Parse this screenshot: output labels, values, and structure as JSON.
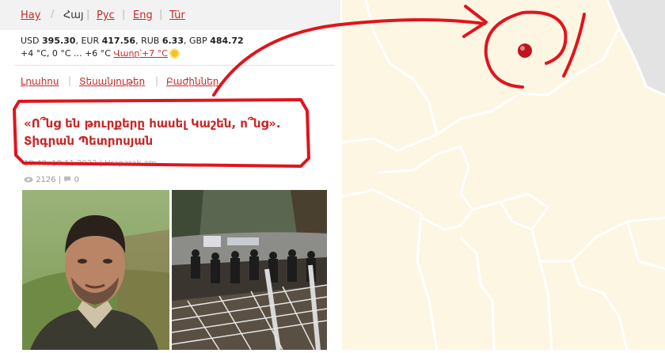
{
  "languages": [
    "Հայ",
    "Հայ",
    "Рус",
    "Eng",
    "Tür"
  ],
  "languages_display": {
    "hay_latin": "Hay",
    "hay": "Հայ",
    "rus": "Рус",
    "eng": "Eng",
    "tur": "Tür"
  },
  "rates": {
    "usd_label": "USD",
    "usd": "395.30",
    "eur_label": "EUR",
    "eur": "417.56",
    "rub_label": "RUB",
    "rub": "6.33",
    "gbp_label": "GBP",
    "gbp": "484.72"
  },
  "weather": {
    "temps": "+4 °C, 0 °C ... +6 °C",
    "tomorrow": "Վաղը՝+7 °C"
  },
  "nav": {
    "news": "Լրահոս",
    "videos": "Տեսանյութեր",
    "sections": "Բաժիններ"
  },
  "article": {
    "title": "«Ո՞նց են թուրքերը հասել Կաշեն, ո՞նց». Տիգրան Պետրոսյան",
    "date": "19:40, 10.11.2022 | Hraparak.am",
    "views": "2126",
    "comments": "0"
  },
  "colors": {
    "accent": "#c62828",
    "annotation": "#e1141c",
    "map_land": "#fcf6e3",
    "map_border": "#ffffff",
    "map_outside": "#e3e3e3",
    "marker": "#c0141e"
  }
}
